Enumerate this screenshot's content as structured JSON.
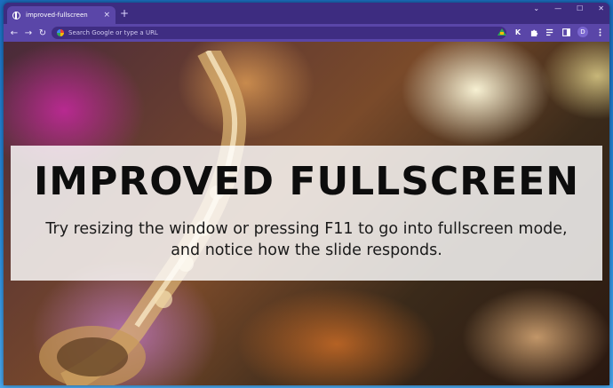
{
  "browser": {
    "tab_title": "improved-fullscreen",
    "tab_close": "×",
    "new_tab": "+",
    "window_controls": [
      "⌄",
      "—",
      "☐",
      "✕"
    ],
    "nav": {
      "back": "←",
      "forward": "→",
      "reload": "↻"
    },
    "omnibox_placeholder": "Search Google or type a URL",
    "profile_initial": "D",
    "toolbar_icons": [
      "drive-icon",
      "k-extension-icon",
      "puzzle-extensions-icon",
      "reading-list-icon",
      "side-panel-icon"
    ]
  },
  "page": {
    "headline": "IMPROVED FULLSCREEN",
    "subtext_line1": "Try resizing the window or pressing F11 to go into fullscreen mode,",
    "subtext_line2": "and notice how the slide responds."
  },
  "colors": {
    "frame": "#3d2c80",
    "toolbar": "#5a46a8",
    "omnibox": "#3f2d82",
    "caption_overlay": "rgba(255,255,255,0.82)"
  }
}
